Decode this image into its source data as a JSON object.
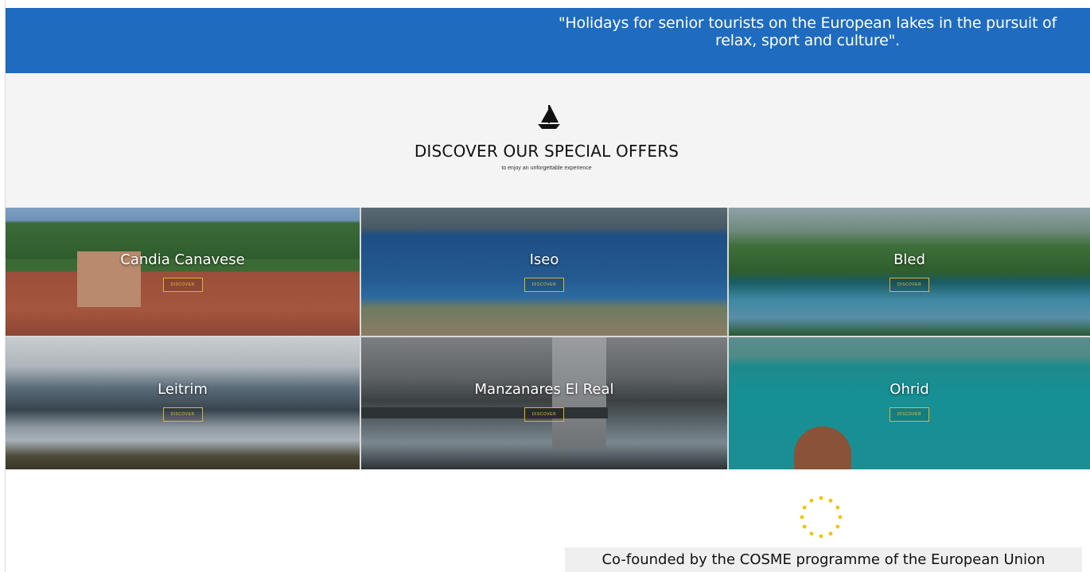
{
  "banner": {
    "quote": "\"Holidays for senior tourists on the European lakes in the pursuit of relax, sport and culture\"."
  },
  "offers": {
    "icon": "sailboat-icon",
    "title": "DISCOVER OUR SPECIAL OFFERS",
    "subtitle": "to enjoy an unforgettable experience"
  },
  "destinations": [
    {
      "name": "Candia Canavese",
      "button": "DISCOVER"
    },
    {
      "name": "Iseo",
      "button": "DISCOVER"
    },
    {
      "name": "Bled",
      "button": "DISCOVER"
    },
    {
      "name": "Leitrim",
      "button": "DISCOVER"
    },
    {
      "name": "Manzanares El Real",
      "button": "DISCOVER"
    },
    {
      "name": "Ohrid",
      "button": "DISCOVER"
    }
  ],
  "footer": {
    "icon": "eu-flag-icon",
    "text": "Co-founded by the COSME programme of the European Union"
  },
  "colors": {
    "banner": "#1f6bbf",
    "button_border": "#d8b532",
    "eu_star": "#f2c500"
  }
}
